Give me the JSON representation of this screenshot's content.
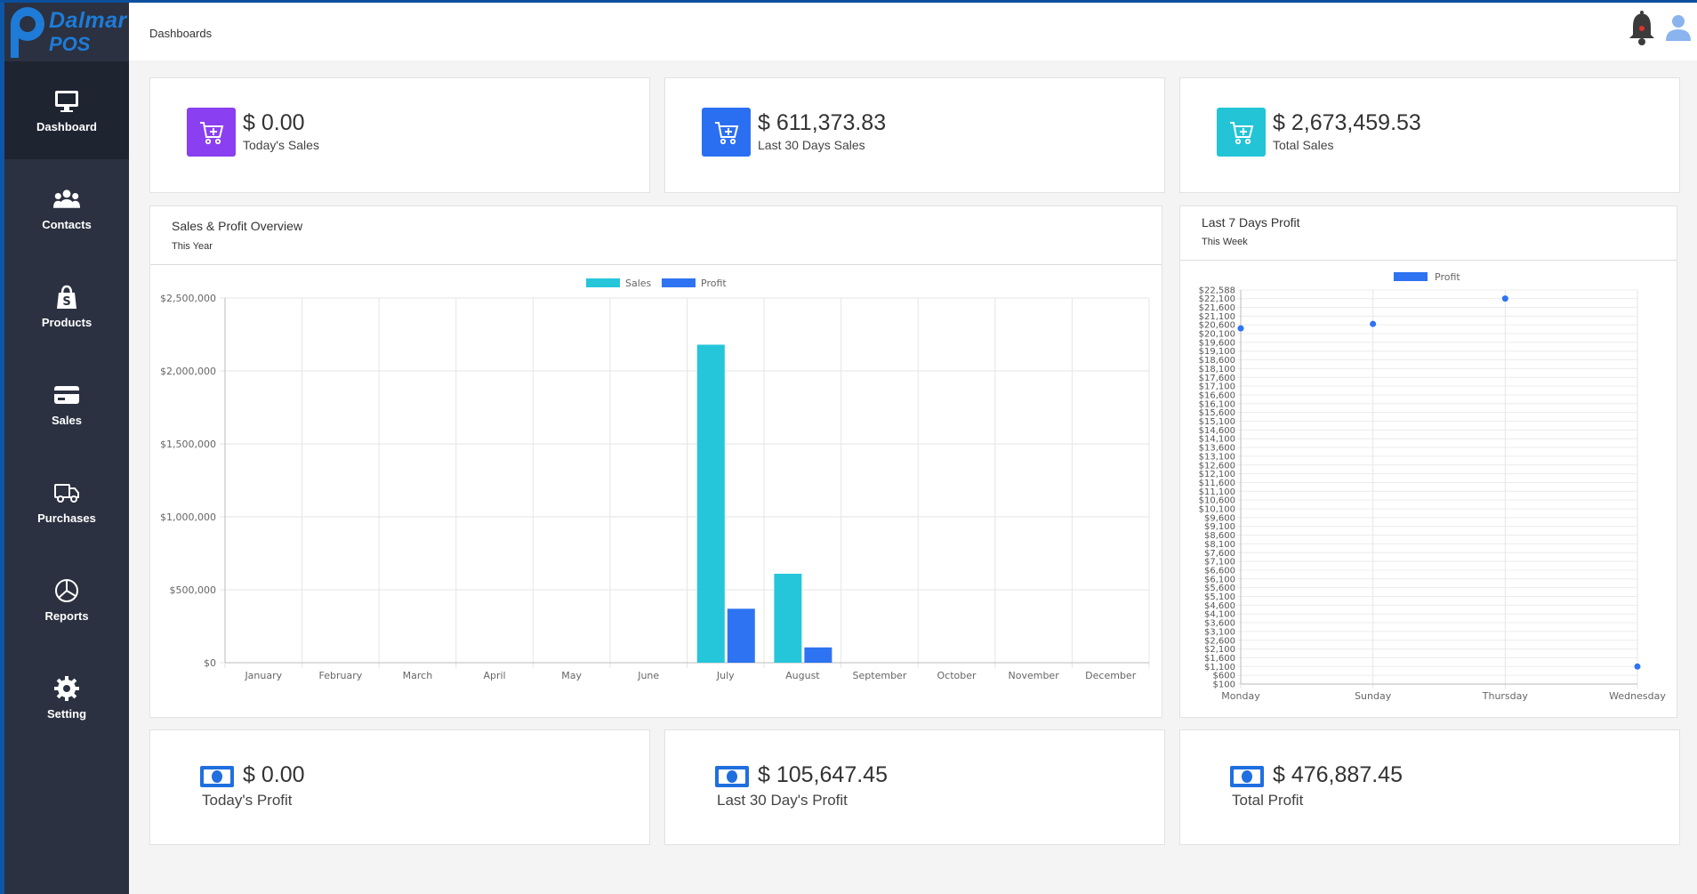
{
  "app": {
    "brand_line1": "Dalmar",
    "brand_line2": "POS"
  },
  "header": {
    "breadcrumb": "Dashboards"
  },
  "sidebar": {
    "items": [
      {
        "label": "Dashboard",
        "icon": "monitor-icon",
        "active": true
      },
      {
        "label": "Contacts",
        "icon": "users-icon"
      },
      {
        "label": "Products",
        "icon": "shopping-bag-icon"
      },
      {
        "label": "Sales",
        "icon": "credit-card-icon"
      },
      {
        "label": "Purchases",
        "icon": "truck-icon"
      },
      {
        "label": "Reports",
        "icon": "pie-chart-icon"
      },
      {
        "label": "Setting",
        "icon": "gear-icon"
      }
    ]
  },
  "colors": {
    "purple": "#8a3ff0",
    "blue": "#2a6ff2",
    "teal": "#22c4d6",
    "sales_bar": "#25c6da",
    "profit_bar": "#2e73f1"
  },
  "sales_cards": [
    {
      "value": "$ 0.00",
      "label": "Today's Sales"
    },
    {
      "value": "$ 611,373.83",
      "label": "Last 30 Days Sales"
    },
    {
      "value": "$ 2,673,459.53",
      "label": "Total Sales"
    }
  ],
  "profit_cards": [
    {
      "value": "$ 0.00",
      "label": "Today's Profit"
    },
    {
      "value": "$ 105,647.45",
      "label": "Last 30 Day's Profit"
    },
    {
      "value": "$ 476,887.45",
      "label": "Total Profit"
    }
  ],
  "overview": {
    "title": "Sales & Profit Overview",
    "subtitle": "This Year"
  },
  "weekly": {
    "title": "Last 7 Days Profit",
    "subtitle": "This Week"
  },
  "chart_data": [
    {
      "type": "bar",
      "categories": [
        "January",
        "February",
        "March",
        "April",
        "May",
        "June",
        "July",
        "August",
        "September",
        "October",
        "November",
        "December"
      ],
      "series": [
        {
          "name": "Sales",
          "values": [
            0,
            0,
            0,
            0,
            0,
            0,
            2180000,
            610000,
            0,
            0,
            0,
            0
          ]
        },
        {
          "name": "Profit",
          "values": [
            0,
            0,
            0,
            0,
            0,
            0,
            370000,
            105000,
            0,
            0,
            0,
            0
          ]
        }
      ],
      "yticks": [
        "$0",
        "$500,000",
        "$1,000,000",
        "$1,500,000",
        "$2,000,000",
        "$2,500,000"
      ],
      "ylim": [
        0,
        2500000
      ],
      "grid": true,
      "legend": "top-center"
    },
    {
      "type": "scatter",
      "categories": [
        "Monday",
        "Sunday",
        "Thursday",
        "Wednesday"
      ],
      "series": [
        {
          "name": "Profit",
          "values": [
            20400,
            20650,
            22100,
            1100
          ]
        }
      ],
      "yticks": [
        "$100",
        "$600",
        "$1,100",
        "$1,600",
        "$2,100",
        "$2,600",
        "$3,100",
        "$3,600",
        "$4,100",
        "$4,600",
        "$5,100",
        "$5,600",
        "$6,100",
        "$6,600",
        "$7,100",
        "$7,600",
        "$8,100",
        "$8,600",
        "$9,100",
        "$9,600",
        "$10,100",
        "$10,600",
        "$11,100",
        "$11,600",
        "$12,100",
        "$12,600",
        "$13,100",
        "$13,600",
        "$14,100",
        "$14,600",
        "$15,100",
        "$15,600",
        "$16,100",
        "$16,600",
        "$17,100",
        "$17,600",
        "$18,100",
        "$18,600",
        "$19,100",
        "$19,600",
        "$20,100",
        "$20,600",
        "$21,100",
        "$21,600",
        "$22,100",
        "$22,588"
      ],
      "ylim": [
        100,
        22588
      ],
      "grid": true,
      "legend": "top-center"
    }
  ]
}
